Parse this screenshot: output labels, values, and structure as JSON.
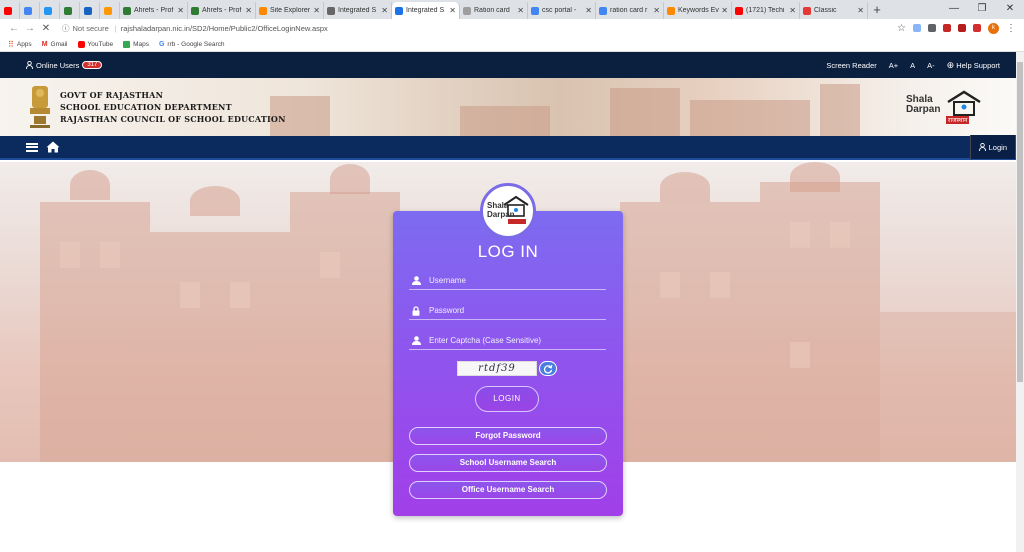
{
  "browser": {
    "tabs": [
      {
        "label": "",
        "color": "#ff0000",
        "small": true
      },
      {
        "label": "",
        "color": "#4285f4",
        "small": true
      },
      {
        "label": "",
        "color": "#2196f3",
        "small": true
      },
      {
        "label": "",
        "color": "#2e7d32",
        "small": true
      },
      {
        "label": "",
        "color": "#1565c0",
        "small": true
      },
      {
        "label": "",
        "color": "#ff9800",
        "small": true
      },
      {
        "label": "Ahrefs - Prof",
        "color": "#2e7d32",
        "small": false
      },
      {
        "label": "Ahrefs - Prof",
        "color": "#2e7d32",
        "small": false
      },
      {
        "label": "Site Explorer",
        "color": "#ff8800",
        "small": false
      },
      {
        "label": "Integrated S",
        "color": "#666666",
        "small": false
      },
      {
        "label": "Integrated S",
        "color": "#1a73e8",
        "small": false,
        "active": true
      },
      {
        "label": "Ration card",
        "color": "#9e9e9e",
        "small": false
      },
      {
        "label": "csc portal -",
        "color": "#4285f4",
        "small": false
      },
      {
        "label": "ration card r",
        "color": "#4285f4",
        "small": false
      },
      {
        "label": "Keywords Ev",
        "color": "#ff8800",
        "small": false
      },
      {
        "label": "(1721) Techi",
        "color": "#ff0000",
        "small": false
      },
      {
        "label": "Classic",
        "color": "#e53935",
        "small": false
      }
    ],
    "new_tab": "+",
    "window_controls": [
      "—",
      "❐",
      "✕"
    ],
    "address": {
      "not_secure": "Not secure",
      "url": "rajshaladarpan.nic.in/SD2/Home/Public2/OfficeLoginNew.aspx"
    },
    "bookmarks": [
      {
        "label": "Apps",
        "color": "#d84315"
      },
      {
        "label": "Gmail",
        "color": "#d93025"
      },
      {
        "label": "YouTube",
        "color": "#ff0000"
      },
      {
        "label": "Maps",
        "color": "#34a853"
      },
      {
        "label": "rrb - Google Search",
        "color": "#4285f4"
      }
    ],
    "profile_initial": "k"
  },
  "site": {
    "topbar": {
      "online_users_label": "Online Users",
      "online_users_count": "317",
      "screen_reader": "Screen Reader",
      "font_plus": "A+",
      "font_normal": "A",
      "font_minus": "A-",
      "help": "Help Support"
    },
    "header": {
      "line1": "GOVT OF RAJASTHAN",
      "line2": "SCHOOL EDUCATION DEPARTMENT",
      "line3": "RAJASTHAN COUNCIL OF SCHOOL EDUCATION",
      "logo_word1": "Shala",
      "logo_word2": "Darpan",
      "logo_sub": "राजस्थान"
    },
    "nav": {
      "login_label": "Login"
    }
  },
  "login": {
    "title": "LOG IN",
    "username_placeholder": "Username",
    "password_placeholder": "Password",
    "captcha_placeholder": "Enter Captcha (Case Sensitive)",
    "captcha_text": "rtdf39",
    "login_button": "LOGIN",
    "forgot_password": "Forgot Password",
    "school_username_search": "School Username Search",
    "office_username_search": "Office Username Search"
  }
}
